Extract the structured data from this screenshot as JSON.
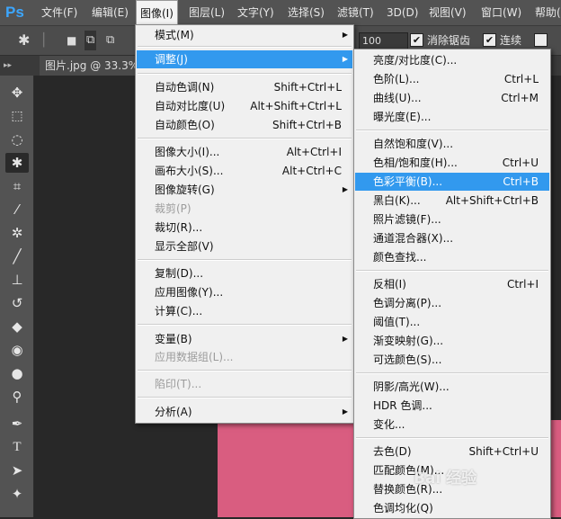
{
  "menubar": {
    "items": [
      "文件(F)",
      "编辑(E)",
      "图像(I)",
      "图层(L)",
      "文字(Y)",
      "选择(S)",
      "滤镜(T)",
      "3D(D)",
      "视图(V)",
      "窗口(W)",
      "帮助("
    ],
    "logo": "Ps"
  },
  "options": {
    "field_value": "100",
    "antialias_label": "消除锯齿",
    "contiguous_label": "连续"
  },
  "document_tab": {
    "title": "图片.jpg @ 33.3%"
  },
  "image_menu": {
    "items": [
      {
        "label": "模式(M)",
        "shortcut": "",
        "submenu": true
      },
      {
        "label": "调整(J)",
        "shortcut": "",
        "submenu": true
      },
      {
        "label": "自动色调(N)",
        "shortcut": "Shift+Ctrl+L"
      },
      {
        "label": "自动对比度(U)",
        "shortcut": "Alt+Shift+Ctrl+L"
      },
      {
        "label": "自动颜色(O)",
        "shortcut": "Shift+Ctrl+B"
      },
      {
        "label": "图像大小(I)...",
        "shortcut": "Alt+Ctrl+I"
      },
      {
        "label": "画布大小(S)...",
        "shortcut": "Alt+Ctrl+C"
      },
      {
        "label": "图像旋转(G)",
        "shortcut": "",
        "submenu": true
      },
      {
        "label": "裁剪(P)",
        "shortcut": "",
        "disabled": true
      },
      {
        "label": "裁切(R)...",
        "shortcut": ""
      },
      {
        "label": "显示全部(V)",
        "shortcut": ""
      },
      {
        "label": "复制(D)...",
        "shortcut": ""
      },
      {
        "label": "应用图像(Y)...",
        "shortcut": ""
      },
      {
        "label": "计算(C)...",
        "shortcut": ""
      },
      {
        "label": "变量(B)",
        "shortcut": "",
        "submenu": true
      },
      {
        "label": "应用数据组(L)...",
        "shortcut": "",
        "disabled": true
      },
      {
        "label": "陷印(T)...",
        "shortcut": "",
        "disabled": true
      },
      {
        "label": "分析(A)",
        "shortcut": "",
        "submenu": true
      }
    ]
  },
  "adjust_menu": {
    "items": [
      {
        "label": "亮度/对比度(C)...",
        "shortcut": ""
      },
      {
        "label": "色阶(L)...",
        "shortcut": "Ctrl+L"
      },
      {
        "label": "曲线(U)...",
        "shortcut": "Ctrl+M"
      },
      {
        "label": "曝光度(E)...",
        "shortcut": ""
      },
      {
        "label": "自然饱和度(V)...",
        "shortcut": ""
      },
      {
        "label": "色相/饱和度(H)...",
        "shortcut": "Ctrl+U"
      },
      {
        "label": "色彩平衡(B)...",
        "shortcut": "Ctrl+B"
      },
      {
        "label": "黑白(K)...",
        "shortcut": "Alt+Shift+Ctrl+B"
      },
      {
        "label": "照片滤镜(F)...",
        "shortcut": ""
      },
      {
        "label": "通道混合器(X)...",
        "shortcut": ""
      },
      {
        "label": "颜色查找...",
        "shortcut": ""
      },
      {
        "label": "反相(I)",
        "shortcut": "Ctrl+I"
      },
      {
        "label": "色调分离(P)...",
        "shortcut": ""
      },
      {
        "label": "阈值(T)...",
        "shortcut": ""
      },
      {
        "label": "渐变映射(G)...",
        "shortcut": ""
      },
      {
        "label": "可选颜色(S)...",
        "shortcut": ""
      },
      {
        "label": "阴影/高光(W)...",
        "shortcut": ""
      },
      {
        "label": "HDR 色调...",
        "shortcut": ""
      },
      {
        "label": "变化...",
        "shortcut": ""
      },
      {
        "label": "去色(D)",
        "shortcut": "Shift+Ctrl+U"
      },
      {
        "label": "匹配颜色(M)...",
        "shortcut": ""
      },
      {
        "label": "替换颜色(R)...",
        "shortcut": ""
      },
      {
        "label": "色调均化(Q)",
        "shortcut": ""
      }
    ]
  },
  "watermark": {
    "text": "Bai 经验"
  },
  "colors": {
    "highlight": "#3299ee",
    "image_pink": "#d95d80",
    "logo_blue": "#3ca6ff"
  }
}
